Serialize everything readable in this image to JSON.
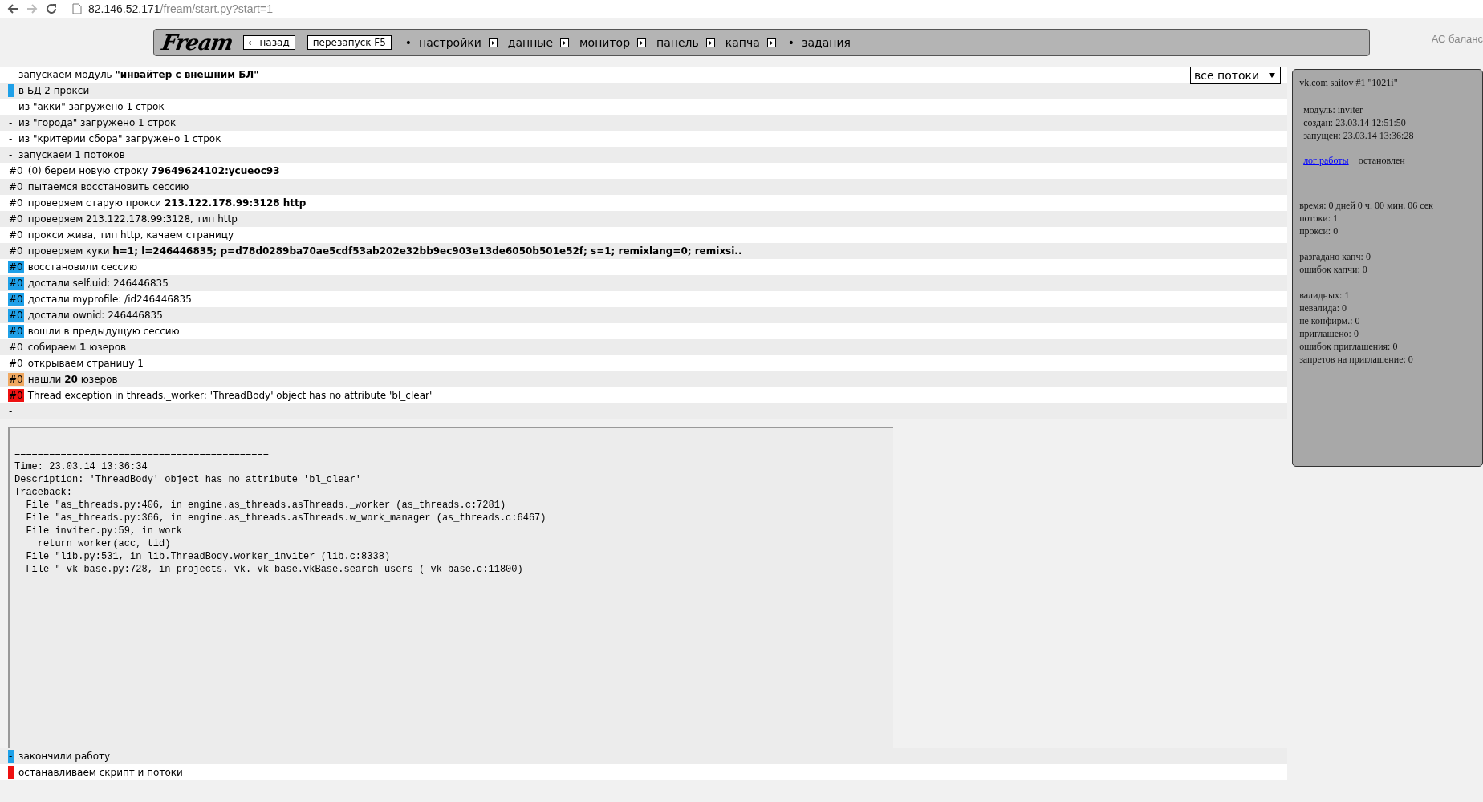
{
  "browser": {
    "back_disabled": false,
    "forward_disabled": true,
    "url_host": "82.146.52.171",
    "url_path": "/fream/start.py?start=1"
  },
  "nav": {
    "logo": "Fream",
    "buttons": [
      "← назад",
      "перезапуск F5"
    ],
    "items": [
      {
        "bullet": "•",
        "label": "настройки",
        "submenu": true
      },
      {
        "label": "данные",
        "submenu": true
      },
      {
        "label": "монитор",
        "submenu": true
      },
      {
        "label": "панель",
        "submenu": true
      },
      {
        "label": "капча",
        "submenu": true
      },
      {
        "bullet": "•",
        "label": "задания",
        "submenu": false
      }
    ]
  },
  "corner_text": "АС баланс",
  "thread_select": {
    "value": "все потоки"
  },
  "log": [
    {
      "marker": "-",
      "text": "запускаем модуль **\"инвайтер с внешним БЛ\"**"
    },
    {
      "marker": "-",
      "color": "#1ea0e8",
      "text": "в БД 2 прокси"
    },
    {
      "marker": "-",
      "text": "из \"акки\" загружено 1 строк"
    },
    {
      "marker": "-",
      "text": "из \"города\" загружено 1 строк"
    },
    {
      "marker": "-",
      "text": "из \"критерии сбора\" загружено 1 строк"
    },
    {
      "marker": "-",
      "text": "запускаем 1 потоков"
    },
    {
      "marker": "#0",
      "text": "(0) берем новую строку **79649624102:ycueoc93**"
    },
    {
      "marker": "#0",
      "text": "пытаемся восстановить сессию"
    },
    {
      "marker": "#0",
      "text": "проверяем старую прокси **213.122.178.99:3128 http**"
    },
    {
      "marker": "#0",
      "text": "проверяем 213.122.178.99:3128, тип http"
    },
    {
      "marker": "#0",
      "text": "прокси жива, тип http, качаем страницу"
    },
    {
      "marker": "#0",
      "text": "проверяем куки **h=1; l=246446835; p=d78d0289ba70ae5cdf53ab202e32bb9ec903e13de6050b501e52f; s=1; remixlang=0; remixsi..**"
    },
    {
      "marker": "#0",
      "color": "#1ea0e8",
      "text": "восстановили сессию"
    },
    {
      "marker": "#0",
      "color": "#1ea0e8",
      "text": "достали self.uid: 246446835"
    },
    {
      "marker": "#0",
      "color": "#1ea0e8",
      "text": "достали myprofile: /id246446835"
    },
    {
      "marker": "#0",
      "color": "#1ea0e8",
      "text": "достали ownid: 246446835"
    },
    {
      "marker": "#0",
      "color": "#1ea0e8",
      "text": "вошли в предыдущую сессию"
    },
    {
      "marker": "#0",
      "text": "собираем **1** юзеров"
    },
    {
      "marker": "#0",
      "text": "открываем страницу 1"
    },
    {
      "marker": "#0",
      "color": "#f0a860",
      "text": "нашли **20** юзеров"
    },
    {
      "marker": "#0",
      "color": "#ee1111",
      "text": "Thread exception in threads._worker: 'ThreadBody' object has no attribute 'bl_clear'"
    },
    {
      "marker": "-"
    }
  ],
  "error_box": {
    "lines": [
      "============================================",
      "Time: 23.03.14 13:36:34",
      "Description: 'ThreadBody' object has no attribute 'bl_clear'",
      "Traceback:",
      "  File \"as_threads.py:406, in engine.as_threads.asThreads._worker (as_threads.c:7281)",
      "  File \"as_threads.py:366, in engine.as_threads.asThreads.w_work_manager (as_threads.c:6467)",
      "  File inviter.py:59, in work",
      "    return worker(acc, tid)",
      "  File \"lib.py:531, in lib.ThreadBody.worker_inviter (lib.c:8338)",
      "  File \"_vk_base.py:728, in projects._vk._vk_base.vkBase.search_users (_vk_base.c:11800)"
    ]
  },
  "log_end": [
    {
      "marker": "-",
      "color": "#1ea0e8",
      "text": "закончили работу"
    },
    {
      "color": "#ee1111",
      "text": "останавливаем скрипт и потоки"
    }
  ],
  "panel": {
    "title": "vk.com saitov #1 \"1021i\"",
    "info": [
      "модуль: inviter",
      "создан: 23.03.14 12:51:50",
      "запущен: 23.03.14 13:36:28"
    ],
    "log_link": "лог работы",
    "status": "остановлен",
    "stat_groups": [
      [
        "время: 0 дней 0 ч. 00 мин. 06 сек",
        "потоки: 1",
        "прокси: 0"
      ],
      [
        "разгадано капч: 0",
        "ошибок капчи: 0"
      ],
      [
        "валидных: 1",
        "невалида: 0",
        "не конфирм.: 0",
        "приглашено: 0",
        "ошибок приглашения: 0",
        "запретов на приглашение: 0"
      ]
    ]
  }
}
